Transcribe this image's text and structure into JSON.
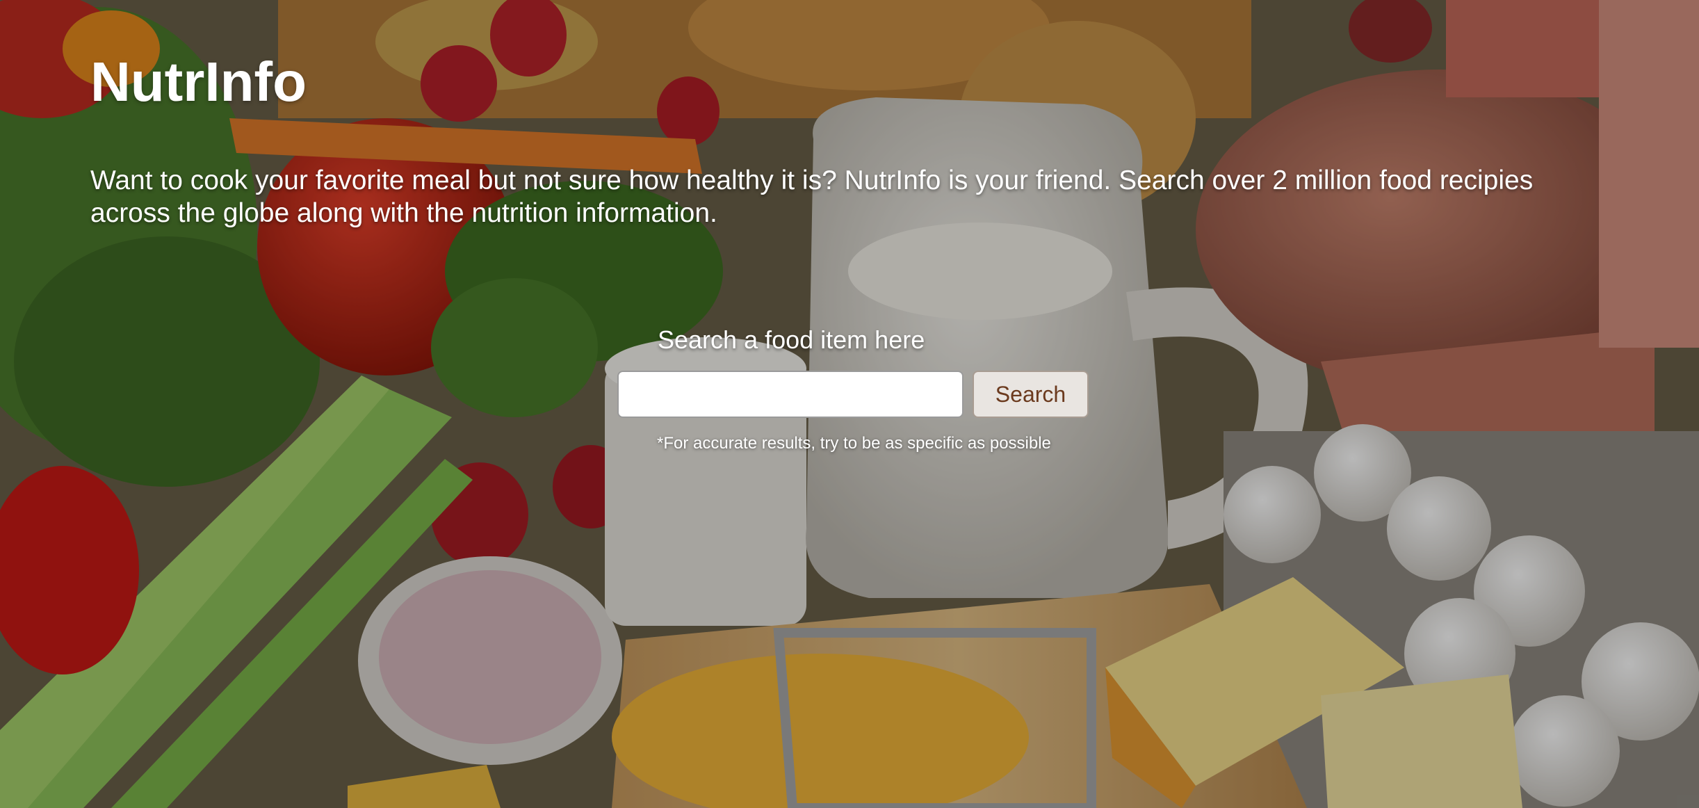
{
  "brand": {
    "title": "NutrInfo"
  },
  "hero": {
    "tagline": "Want to cook your favorite meal but not sure how healthy it is? NutrInfo is your friend. Search over 2 million food recipies across the globe along with the nutrition information."
  },
  "search": {
    "label": "Search a food item here",
    "input_value": "",
    "placeholder": "",
    "button_label": "Search",
    "hint": "*For accurate results, try to be as specific as possible"
  },
  "colors": {
    "heading_text": "#ffffff",
    "button_background": "#e9e5e1",
    "button_text": "#6b3a1e"
  }
}
